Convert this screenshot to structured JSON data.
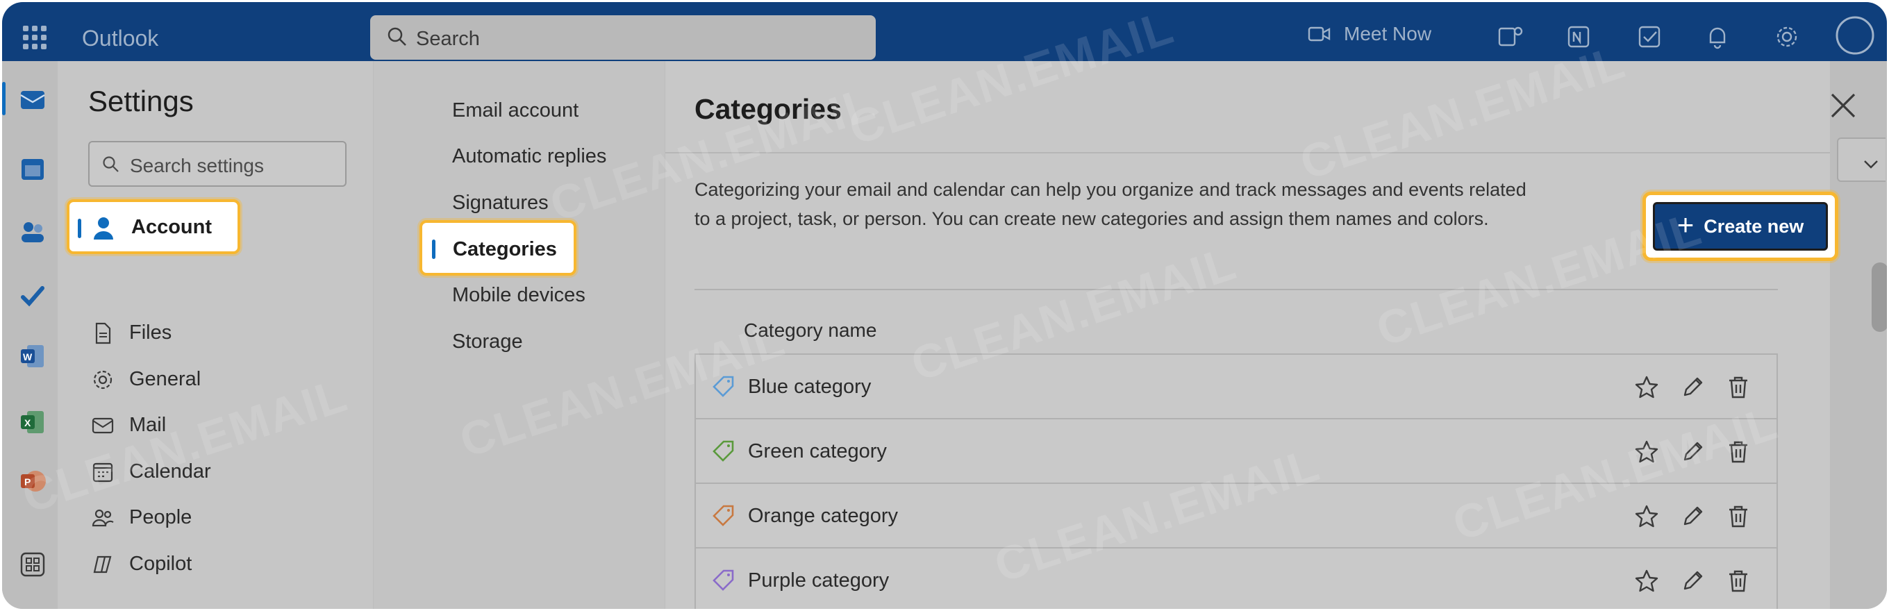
{
  "app": {
    "name": "Outlook"
  },
  "search": {
    "placeholder": "Search"
  },
  "topbar": {
    "meet_now": "Meet Now"
  },
  "settings": {
    "title": "Settings",
    "search_placeholder": "Search settings",
    "nav": [
      {
        "label": "Account",
        "icon": "person-icon",
        "active": true
      },
      {
        "label": "Files",
        "icon": "document-icon"
      },
      {
        "label": "General",
        "icon": "gear-icon"
      },
      {
        "label": "Mail",
        "icon": "mail-icon"
      },
      {
        "label": "Calendar",
        "icon": "calendar-icon"
      },
      {
        "label": "People",
        "icon": "people-icon"
      },
      {
        "label": "Copilot",
        "icon": "copilot-icon"
      }
    ],
    "subnav": [
      {
        "label": "Email account"
      },
      {
        "label": "Automatic replies"
      },
      {
        "label": "Signatures"
      },
      {
        "label": "Categories",
        "active": true
      },
      {
        "label": "Mobile devices"
      },
      {
        "label": "Storage"
      }
    ]
  },
  "pane": {
    "title": "Categories",
    "description": "Categorizing your email and calendar can help you organize and track messages and events related to a project, task, or person. You can create new categories and assign them names and colors.",
    "create_label": "Create new",
    "column_header": "Category name",
    "categories": [
      {
        "name": "Blue category",
        "color": "#5b9bd5"
      },
      {
        "name": "Green category",
        "color": "#5a9a3c"
      },
      {
        "name": "Orange category",
        "color": "#c87941"
      },
      {
        "name": "Purple category",
        "color": "#8a6bc9"
      }
    ]
  },
  "watermark": "CLEAN.EMAIL",
  "colors": {
    "topbar": "#0f3f7c",
    "highlight": "#f7b731",
    "accent": "#0f6cbd"
  }
}
